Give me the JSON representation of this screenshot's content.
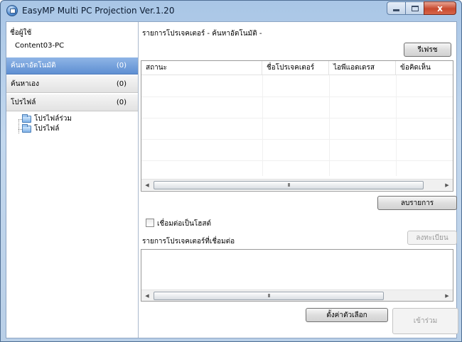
{
  "window": {
    "title": "EasyMP Multi PC Projection Ver.1.20",
    "close_glyph": "x"
  },
  "left_panel": {
    "user_label": "ชื่อผู้ใช้",
    "user_name": "Content03-PC",
    "nav": [
      {
        "label": "ค้นหาอัตโนมัติ",
        "count": "(0)",
        "active": true
      },
      {
        "label": "ค้นหาเอง",
        "count": "(0)",
        "active": false
      },
      {
        "label": "โปรไฟล์",
        "count": "(0)",
        "active": false
      }
    ],
    "tree": [
      {
        "label": "โปรไฟล์ร่วม",
        "icon": "folder-icon"
      },
      {
        "label": "โปรไฟล์",
        "icon": "folder-icon"
      }
    ]
  },
  "main": {
    "projector_list_title": "รายการโปรเจคเตอร์ - ค้นหาอัตโนมัติ -",
    "refresh_button": "รีเฟรช",
    "columns": [
      "สถานะ",
      "ชื่อโปรเจคเตอร์",
      "ไอพีแอดเดรส",
      "ข้อคิดเห็น"
    ],
    "scroll_grip": "III",
    "remove_button": "ลบรายการ",
    "host_checkbox_label": "เชื่อมต่อเป็นโฮสต์",
    "host_checkbox_checked": false,
    "connected_list_title": "รายการโปรเจคเตอร์ที่เชื่อมต่อ",
    "register_button": "ลงทะเบียน",
    "settings_button": "ตั้งค่าตัวเลือก",
    "join_button": "เข้าร่วม"
  }
}
